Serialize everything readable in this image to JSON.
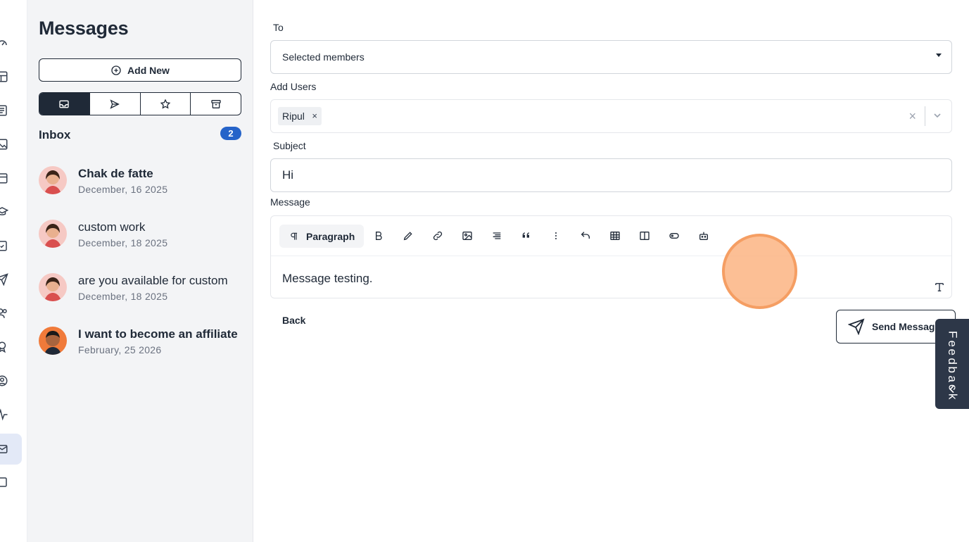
{
  "panel": {
    "title": "Messages",
    "add_new_label": "Add New",
    "inbox_label": "Inbox",
    "inbox_count": "2",
    "messages": [
      {
        "title": "Chak de fatte",
        "date": "December, 16 2025",
        "unread": true
      },
      {
        "title": "custom work",
        "date": "December, 18 2025",
        "unread": false
      },
      {
        "title": "are you available for custom",
        "date": "December, 18 2025",
        "unread": false
      },
      {
        "title": "I want to become an affiliate",
        "date": "February, 25 2026",
        "unread": true
      }
    ]
  },
  "compose": {
    "to_label": "To",
    "to_value": "Selected members",
    "add_users_label": "Add Users",
    "user_chip": "Ripul",
    "chip_remove": "×",
    "clear_all": "×",
    "subject_label": "Subject",
    "subject_value": "Hi",
    "message_label": "Message",
    "paragraph_label": "Paragraph",
    "message_body": "Message testing.",
    "back_label": "Back",
    "send_label": "Send Message"
  },
  "feedback": {
    "letters": [
      "F",
      "e",
      "e",
      "d",
      "b",
      "a",
      "c",
      "k"
    ]
  },
  "colors": {
    "accent": "#2563c9",
    "dark": "#1f2937",
    "panel_bg": "#f3f4f6",
    "feedback_bg": "#2d3748",
    "cursor_ring": "#f59e63"
  }
}
